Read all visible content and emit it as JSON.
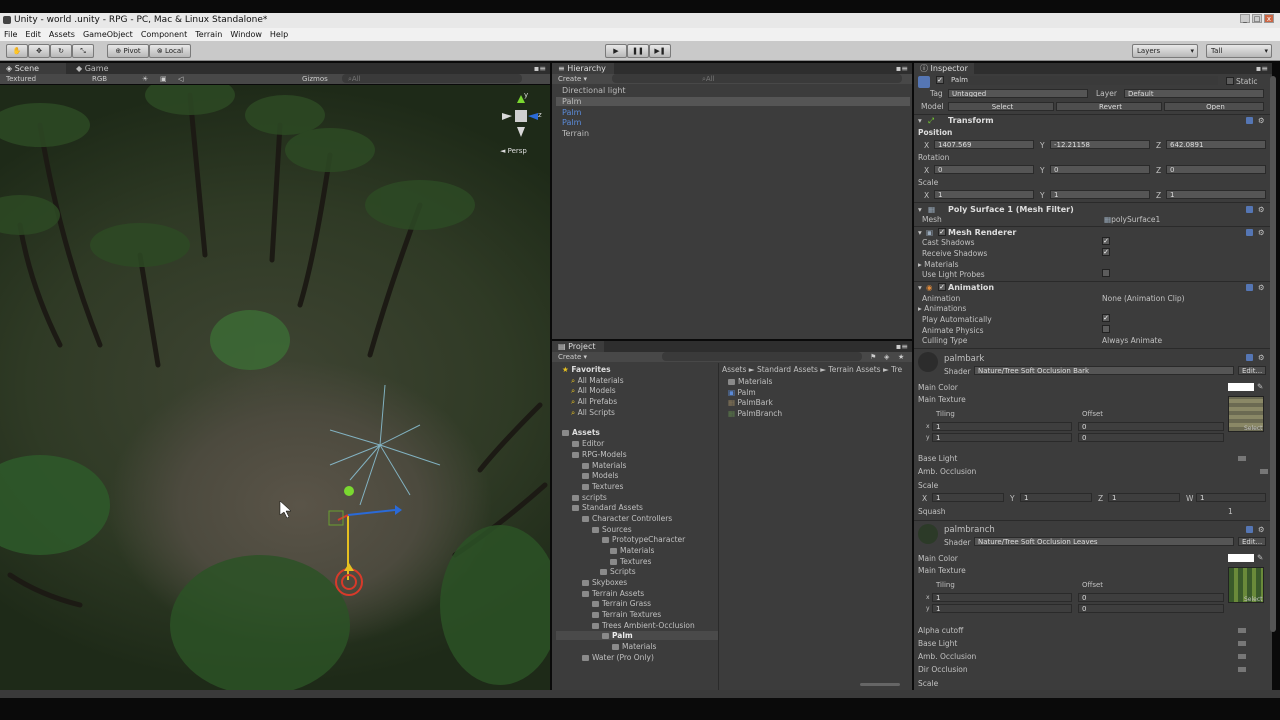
{
  "window": {
    "title": "Unity - world .unity - RPG - PC, Mac & Linux Standalone*"
  },
  "menu": [
    "File",
    "Edit",
    "Assets",
    "GameObject",
    "Component",
    "Terrain",
    "Window",
    "Help"
  ],
  "toolbar": {
    "pivot": "Pivot",
    "local": "Local",
    "layers": "Layers",
    "layout": "Tall"
  },
  "scene": {
    "tab_scene": "Scene",
    "tab_game": "Game",
    "render_mode": "Textured",
    "color_mode": "RGB",
    "gizmos": "Gizmos",
    "search_placeholder": "All",
    "persp": "Persp",
    "axis_y": "y",
    "axis_z": "z"
  },
  "hierarchy": {
    "tab": "Hierarchy",
    "create": "Create",
    "search_placeholder": "All",
    "items": [
      "Directional light",
      "Palm",
      "Palm",
      "Palm",
      "Terrain"
    ]
  },
  "project": {
    "tab": "Project",
    "create": "Create",
    "favorites": {
      "label": "Favorites",
      "items": [
        "All Materials",
        "All Models",
        "All Prefabs",
        "All Scripts"
      ]
    },
    "tree": [
      "Assets",
      "Editor",
      "RPG-Models",
      "Materials",
      "Models",
      "Textures",
      "scripts",
      "Standard Assets",
      "Character Controllers",
      "Sources",
      "PrototypeCharacter",
      "Materials",
      "Textures",
      "Scripts",
      "Skyboxes",
      "Terrain Assets",
      "Terrain Grass",
      "Terrain Textures",
      "Trees Ambient-Occlusion",
      "Palm",
      "Materials",
      "Water (Pro Only)"
    ],
    "breadcrumb": "Assets ► Standard Assets ► Terrain Assets ► Tre",
    "files": [
      "Materials",
      "Palm",
      "PalmBark",
      "PalmBranch"
    ]
  },
  "inspector": {
    "tab": "Inspector",
    "object_name": "Palm",
    "static": "Static",
    "tag_label": "Tag",
    "tag_value": "Untagged",
    "layer_label": "Layer",
    "layer_value": "Default",
    "model_label": "Model",
    "model_select": "Select",
    "model_revert": "Revert",
    "model_open": "Open",
    "transform": {
      "title": "Transform",
      "position": "Position",
      "px": "1407.569",
      "py": "-12.21158",
      "pz": "642.0891",
      "rotation": "Rotation",
      "rx": "0",
      "ry": "0",
      "rz": "0",
      "scale": "Scale",
      "sx": "1",
      "sy": "1",
      "sz": "1"
    },
    "mesh_filter": {
      "title": "Poly Surface 1 (Mesh Filter)",
      "mesh_label": "Mesh",
      "mesh_value": "polySurface1"
    },
    "mesh_renderer": {
      "title": "Mesh Renderer",
      "cast_shadows": "Cast Shadows",
      "receive_shadows": "Receive Shadows",
      "materials": "Materials",
      "use_light_probes": "Use Light Probes"
    },
    "animation": {
      "title": "Animation",
      "animation_label": "Animation",
      "animation_value": "None (Animation Clip)",
      "animations": "Animations",
      "play_auto": "Play Automatically",
      "animate_physics": "Animate Physics",
      "culling_type": "Culling Type",
      "culling_value": "Always Animate"
    },
    "palmbark": {
      "name": "palmbark",
      "shader_label": "Shader",
      "shader_value": "Nature/Tree Soft Occlusion Bark",
      "edit": "Edit...",
      "main_color": "Main Color",
      "main_texture": "Main Texture",
      "tiling": "Tiling",
      "offset": "Offset",
      "tx": "1",
      "ty": "1",
      "ox": "0",
      "oy": "0",
      "base_light": "Base Light",
      "amb_occlusion": "Amb. Occlusion",
      "scale": "Scale",
      "scale_x": "1",
      "scale_y": "1",
      "scale_z": "1",
      "scale_w": "1",
      "squash": "Squash",
      "squash_value": "1",
      "select": "Select"
    },
    "palmbranch": {
      "name": "palmbranch",
      "shader_label": "Shader",
      "shader_value": "Nature/Tree Soft Occlusion Leaves",
      "edit": "Edit...",
      "main_color": "Main Color",
      "main_texture": "Main Texture",
      "tiling": "Tiling",
      "offset": "Offset",
      "tx": "1",
      "ty": "1",
      "ox": "0",
      "oy": "0",
      "alpha_cutoff": "Alpha cutoff",
      "base_light": "Base Light",
      "amb_occlusion": "Amb. Occlusion",
      "dir_occlusion": "Dir Occlusion",
      "scale": "Scale",
      "select": "Select"
    }
  },
  "colors": {
    "accent": "#5576b4",
    "panel": "#3c3c3c",
    "prefab_text": "#5a8ad8"
  }
}
